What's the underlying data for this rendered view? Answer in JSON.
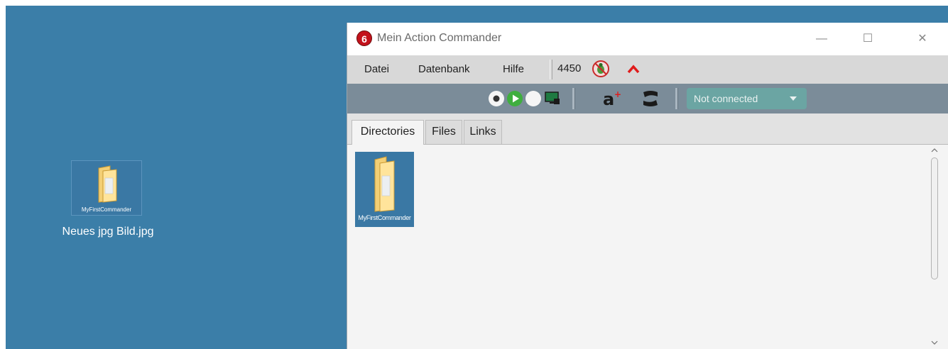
{
  "desktop": {
    "icon_caption": "MyFirstCommander",
    "label": "Neues jpg Bild.jpg"
  },
  "window": {
    "logo": "6",
    "title": "Mein Action Commander",
    "controls": {
      "minimize": "—",
      "maximize": "☐",
      "close": "✕"
    }
  },
  "menubar": {
    "items": [
      "Datei",
      "Datenbank",
      "Hilfe"
    ],
    "count": "4450"
  },
  "toolbar": {
    "connection": "Not connected"
  },
  "tabs": [
    "Directories",
    "Files",
    "Links"
  ],
  "content": {
    "items": [
      {
        "label": "MyFirstCommander"
      }
    ]
  },
  "colors": {
    "desktop": "#3b7ea8",
    "menubar": "#d8d8d8",
    "toolbar": "#7b8c99",
    "connection_box": "#6ba5a3",
    "logo_red": "#c3121c",
    "selection": "#3a78a4"
  }
}
